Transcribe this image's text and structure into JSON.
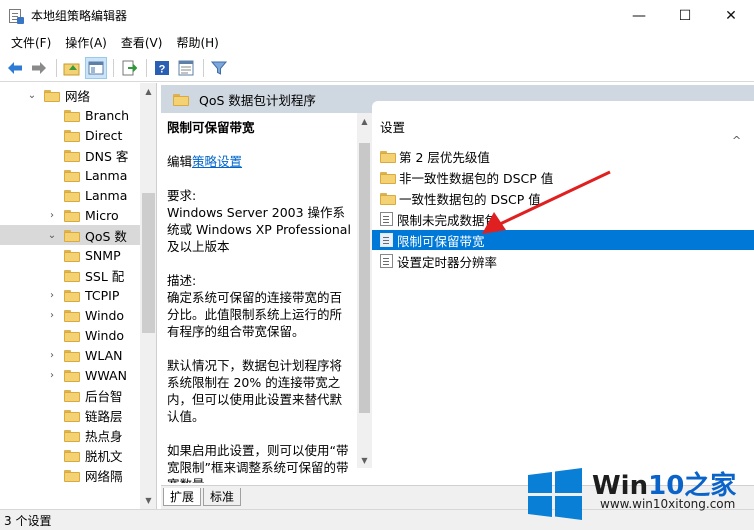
{
  "window": {
    "title": "本地组策略编辑器",
    "controls": [
      "—",
      "☐",
      "✕"
    ]
  },
  "menu": [
    "文件(F)",
    "操作(A)",
    "查看(V)",
    "帮助(H)"
  ],
  "tree": {
    "items": [
      {
        "label": "网络",
        "indent": 1,
        "chev": "v",
        "selected": false
      },
      {
        "label": "Branch",
        "indent": 2,
        "chev": "",
        "selected": false
      },
      {
        "label": "Direct",
        "indent": 2,
        "chev": "",
        "selected": false
      },
      {
        "label": "DNS 客",
        "indent": 2,
        "chev": "",
        "selected": false
      },
      {
        "label": "Lanma",
        "indent": 2,
        "chev": "",
        "selected": false
      },
      {
        "label": "Lanma",
        "indent": 2,
        "chev": "",
        "selected": false
      },
      {
        "label": "Micro",
        "indent": 2,
        "chev": ">",
        "selected": false
      },
      {
        "label": "QoS 数",
        "indent": 2,
        "chev": "v",
        "selected": true
      },
      {
        "label": "SNMP",
        "indent": 2,
        "chev": "",
        "selected": false
      },
      {
        "label": "SSL 配",
        "indent": 2,
        "chev": "",
        "selected": false
      },
      {
        "label": "TCPIP",
        "indent": 2,
        "chev": ">",
        "selected": false
      },
      {
        "label": "Windo",
        "indent": 2,
        "chev": ">",
        "selected": false
      },
      {
        "label": "Windo",
        "indent": 2,
        "chev": "",
        "selected": false
      },
      {
        "label": "WLAN",
        "indent": 2,
        "chev": ">",
        "selected": false
      },
      {
        "label": "WWAN",
        "indent": 2,
        "chev": ">",
        "selected": false
      },
      {
        "label": "后台智",
        "indent": 2,
        "chev": "",
        "selected": false
      },
      {
        "label": "链路层",
        "indent": 2,
        "chev": "",
        "selected": false
      },
      {
        "label": "热点身",
        "indent": 2,
        "chev": "",
        "selected": false
      },
      {
        "label": "脱机文",
        "indent": 2,
        "chev": "",
        "selected": false
      },
      {
        "label": "网络隔",
        "indent": 2,
        "chev": "",
        "selected": false
      }
    ]
  },
  "header": {
    "title": "QoS 数据包计划程序"
  },
  "description": {
    "title": "限制可保留带宽",
    "edit_prefix": "编辑",
    "edit_link": "策略设置",
    "req_label": "要求:",
    "req_text": "Windows Server 2003 操作系统或 Windows XP Professional 及以上版本",
    "desc_label": "描述:",
    "desc_p1": "确定系统可保留的连接带宽的百分比。此值限制系统上运行的所有程序的组合带宽保留。",
    "desc_p2": "默认情况下，数据包计划程序将系统限制在 20% 的连接带宽之内，但可以使用此设置来替代默认值。",
    "desc_p3": "如果启用此设置，则可以使用“带宽限制”框来调整系统可保留的带宽数量。"
  },
  "list": {
    "header": "设置",
    "rows": [
      {
        "label": "第 2 层优先级值",
        "type": "folder",
        "selected": false
      },
      {
        "label": "非一致性数据包的 DSCP 值",
        "type": "folder",
        "selected": false
      },
      {
        "label": "一致性数据包的 DSCP 值",
        "type": "folder",
        "selected": false
      },
      {
        "label": "限制未完成数据包",
        "type": "setting",
        "selected": false
      },
      {
        "label": "限制可保留带宽",
        "type": "setting",
        "selected": true
      },
      {
        "label": "设置定时器分辨率",
        "type": "setting",
        "selected": false
      }
    ]
  },
  "tabs": [
    "扩展",
    "标准"
  ],
  "status": "3 个设置",
  "watermark": {
    "brand": "Win10之家",
    "url": "www.win10xitong.com"
  },
  "colors": {
    "accent": "#0078d7",
    "arrow": "#e02020",
    "header_band": "#cfd7e0"
  }
}
